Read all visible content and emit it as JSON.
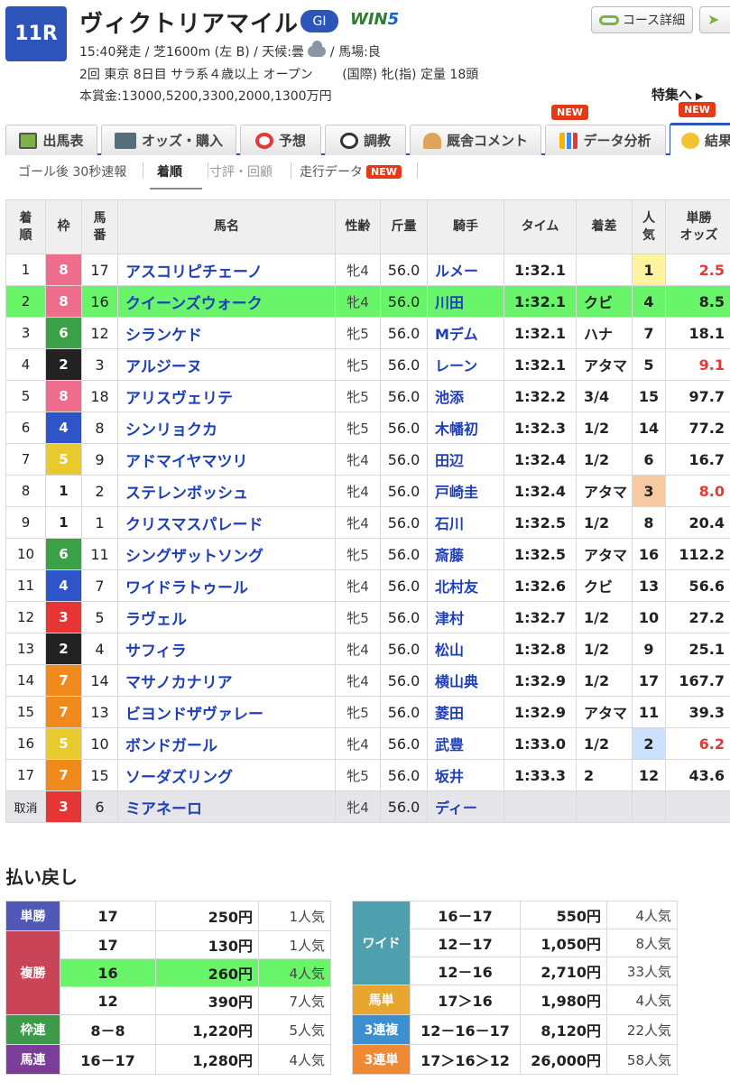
{
  "header": {
    "race_no": "11R",
    "title": "ヴィクトリアマイル",
    "grade": "GI",
    "win5_a": "WIN",
    "win5_b": "5",
    "info_line1_a": "15:40発走 / 芝1600m (左 B) / 天候:曇",
    "info_line1_b": "/ 馬場:良",
    "info_line2": "2回 東京 8日目 サラ系４歳以上 オープン 　　(国際) 牝(指) 定量 18頭",
    "info_line3": "本賞金:13000,5200,3300,2000,1300万円",
    "course_button": "コース詳細",
    "tokushu": "特集へ"
  },
  "tabs": [
    {
      "label": "出馬表"
    },
    {
      "label": "オッズ・購入"
    },
    {
      "label": "予想"
    },
    {
      "label": "調教"
    },
    {
      "label": "厩舎コメント"
    },
    {
      "label": "データ分析",
      "badge": "NEW"
    },
    {
      "label": "結果",
      "badge": "NEW"
    }
  ],
  "subtabs": [
    {
      "label": "ゴール後 30秒速報"
    },
    {
      "label": "着順"
    },
    {
      "label": "寸評・回顧"
    },
    {
      "label": "走行データ",
      "badge": "NEW"
    }
  ],
  "table": {
    "headers": {
      "rank": "着\n順",
      "waku": "枠",
      "umaban": "馬\n番",
      "name": "馬名",
      "sex": "性齢",
      "weight": "斤量",
      "jockey": "騎手",
      "time": "タイム",
      "diff": "着差",
      "pop": "人\n気",
      "odds": "単勝\nオッズ"
    },
    "rows": [
      {
        "rank": "1",
        "waku": "8",
        "umaban": "17",
        "name": "アスコリピチェーノ",
        "sex": "牝4",
        "weight": "56.0",
        "jockey": "ルメー",
        "time": "1:32.1",
        "diff": "",
        "pop": "1",
        "odds": "2.5"
      },
      {
        "rank": "2",
        "waku": "8",
        "umaban": "16",
        "name": "クイーンズウォーク",
        "sex": "牝4",
        "weight": "56.0",
        "jockey": "川田",
        "time": "1:32.1",
        "diff": "クビ",
        "pop": "4",
        "odds": "8.5"
      },
      {
        "rank": "3",
        "waku": "6",
        "umaban": "12",
        "name": "シランケド",
        "sex": "牝5",
        "weight": "56.0",
        "jockey": "Mデム",
        "time": "1:32.1",
        "diff": "ハナ",
        "pop": "7",
        "odds": "18.1"
      },
      {
        "rank": "4",
        "waku": "2",
        "umaban": "3",
        "name": "アルジーヌ",
        "sex": "牝5",
        "weight": "56.0",
        "jockey": "レーン",
        "time": "1:32.1",
        "diff": "アタマ",
        "pop": "5",
        "odds": "9.1"
      },
      {
        "rank": "5",
        "waku": "8",
        "umaban": "18",
        "name": "アリスヴェリテ",
        "sex": "牝5",
        "weight": "56.0",
        "jockey": "池添",
        "time": "1:32.2",
        "diff": "3/4",
        "pop": "15",
        "odds": "97.7"
      },
      {
        "rank": "6",
        "waku": "4",
        "umaban": "8",
        "name": "シンリョクカ",
        "sex": "牝5",
        "weight": "56.0",
        "jockey": "木幡初",
        "time": "1:32.3",
        "diff": "1/2",
        "pop": "14",
        "odds": "77.2"
      },
      {
        "rank": "7",
        "waku": "5",
        "umaban": "9",
        "name": "アドマイヤマツリ",
        "sex": "牝4",
        "weight": "56.0",
        "jockey": "田辺",
        "time": "1:32.4",
        "diff": "1/2",
        "pop": "6",
        "odds": "16.7"
      },
      {
        "rank": "8",
        "waku": "1",
        "umaban": "2",
        "name": "ステレンボッシュ",
        "sex": "牝4",
        "weight": "56.0",
        "jockey": "戸崎圭",
        "time": "1:32.4",
        "diff": "アタマ",
        "pop": "3",
        "odds": "8.0"
      },
      {
        "rank": "9",
        "waku": "1",
        "umaban": "1",
        "name": "クリスマスパレード",
        "sex": "牝4",
        "weight": "56.0",
        "jockey": "石川",
        "time": "1:32.5",
        "diff": "1/2",
        "pop": "8",
        "odds": "20.4"
      },
      {
        "rank": "10",
        "waku": "6",
        "umaban": "11",
        "name": "シングザットソング",
        "sex": "牝5",
        "weight": "56.0",
        "jockey": "斎藤",
        "time": "1:32.5",
        "diff": "アタマ",
        "pop": "16",
        "odds": "112.2"
      },
      {
        "rank": "11",
        "waku": "4",
        "umaban": "7",
        "name": "ワイドラトゥール",
        "sex": "牝4",
        "weight": "56.0",
        "jockey": "北村友",
        "time": "1:32.6",
        "diff": "クビ",
        "pop": "13",
        "odds": "56.6"
      },
      {
        "rank": "12",
        "waku": "3",
        "umaban": "5",
        "name": "ラヴェル",
        "sex": "牝5",
        "weight": "56.0",
        "jockey": "津村",
        "time": "1:32.7",
        "diff": "1/2",
        "pop": "10",
        "odds": "27.2"
      },
      {
        "rank": "13",
        "waku": "2",
        "umaban": "4",
        "name": "サフィラ",
        "sex": "牝4",
        "weight": "56.0",
        "jockey": "松山",
        "time": "1:32.8",
        "diff": "1/2",
        "pop": "9",
        "odds": "25.1"
      },
      {
        "rank": "14",
        "waku": "7",
        "umaban": "14",
        "name": "マサノカナリア",
        "sex": "牝4",
        "weight": "56.0",
        "jockey": "横山典",
        "time": "1:32.9",
        "diff": "1/2",
        "pop": "17",
        "odds": "167.7"
      },
      {
        "rank": "15",
        "waku": "7",
        "umaban": "13",
        "name": "ビヨンドザヴァレー",
        "sex": "牝5",
        "weight": "56.0",
        "jockey": "菱田",
        "time": "1:32.9",
        "diff": "アタマ",
        "pop": "11",
        "odds": "39.3"
      },
      {
        "rank": "16",
        "waku": "5",
        "umaban": "10",
        "name": "ボンドガール",
        "sex": "牝4",
        "weight": "56.0",
        "jockey": "武豊",
        "time": "1:33.0",
        "diff": "1/2",
        "pop": "2",
        "odds": "6.2"
      },
      {
        "rank": "17",
        "waku": "7",
        "umaban": "15",
        "name": "ソーダズリング",
        "sex": "牝5",
        "weight": "56.0",
        "jockey": "坂井",
        "time": "1:33.3",
        "diff": "2",
        "pop": "12",
        "odds": "43.6"
      },
      {
        "rank": "取消",
        "waku": "3",
        "umaban": "6",
        "name": "ミアネーロ",
        "sex": "牝4",
        "weight": "56.0",
        "jockey": "ディー",
        "time": "",
        "diff": "",
        "pop": "",
        "odds": ""
      }
    ]
  },
  "waku_colors": {
    "1": {
      "bg": "#ffffff",
      "fg": "#222222"
    },
    "2": {
      "bg": "#222222",
      "fg": "#ffffff"
    },
    "3": {
      "bg": "#e63535",
      "fg": "#ffffff"
    },
    "4": {
      "bg": "#2d54c8",
      "fg": "#ffffff"
    },
    "5": {
      "bg": "#e8c92e",
      "fg": "#ffffff"
    },
    "6": {
      "bg": "#3aa146",
      "fg": "#ffffff"
    },
    "7": {
      "bg": "#f08a1c",
      "fg": "#ffffff"
    },
    "8": {
      "bg": "#ee6d8c",
      "fg": "#ffffff"
    }
  },
  "payouts": {
    "title": "払い戻し",
    "left": [
      {
        "label": "単勝",
        "color": "#5058b8",
        "rows": [
          {
            "combo": "17",
            "amount": "250円",
            "pop": "1人気"
          }
        ]
      },
      {
        "label": "複勝",
        "color": "#c94456",
        "rows": [
          {
            "combo": "17",
            "amount": "130円",
            "pop": "1人気"
          },
          {
            "combo": "16",
            "amount": "260円",
            "pop": "4人気",
            "hl": true
          },
          {
            "combo": "12",
            "amount": "390円",
            "pop": "7人気"
          }
        ]
      },
      {
        "label": "枠連",
        "color": "#3c9a4a",
        "rows": [
          {
            "combo": "8－8",
            "amount": "1,220円",
            "pop": "5人気"
          }
        ]
      },
      {
        "label": "馬連",
        "color": "#7a3e9a",
        "rows": [
          {
            "combo": "16－17",
            "amount": "1,280円",
            "pop": "4人気"
          }
        ]
      }
    ],
    "right": [
      {
        "label": "ワイド",
        "color": "#4fa0ae",
        "rows": [
          {
            "combo": "16－17",
            "amount": "550円",
            "pop": "4人気"
          },
          {
            "combo": "12－17",
            "amount": "1,050円",
            "pop": "8人気"
          },
          {
            "combo": "12－16",
            "amount": "2,710円",
            "pop": "33人気"
          }
        ]
      },
      {
        "label": "馬単",
        "color": "#e9a62e",
        "rows": [
          {
            "combo": "17＞16",
            "amount": "1,980円",
            "pop": "4人気"
          }
        ]
      },
      {
        "label": "3連複",
        "color": "#3d8fd0",
        "rows": [
          {
            "combo": "12－16－17",
            "amount": "8,120円",
            "pop": "22人気"
          }
        ]
      },
      {
        "label": "3連単",
        "color": "#ef8a33",
        "rows": [
          {
            "combo": "17＞16＞12",
            "amount": "26,000円",
            "pop": "58人気"
          }
        ]
      }
    ]
  }
}
